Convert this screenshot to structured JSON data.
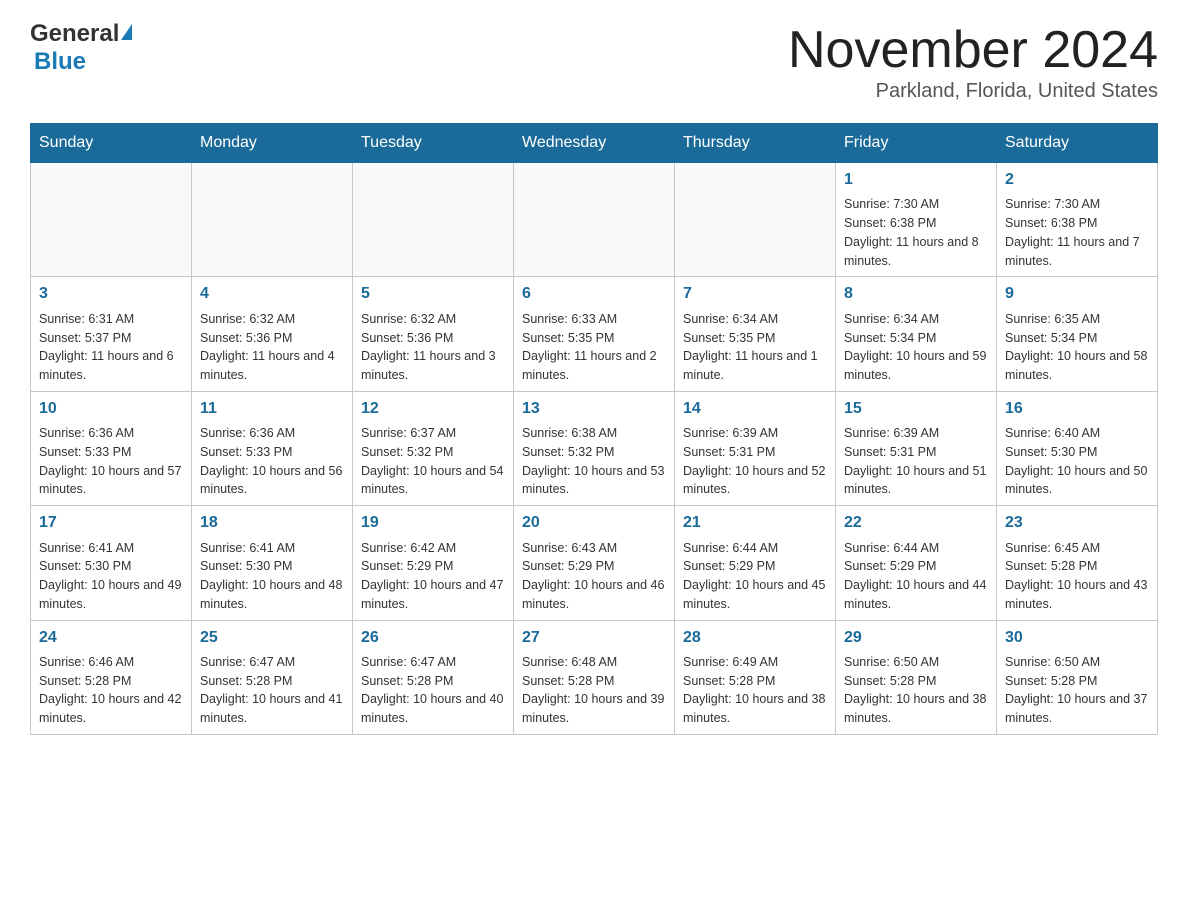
{
  "header": {
    "logo_general": "General",
    "logo_blue": "Blue",
    "month_title": "November 2024",
    "location": "Parkland, Florida, United States"
  },
  "days_of_week": [
    "Sunday",
    "Monday",
    "Tuesday",
    "Wednesday",
    "Thursday",
    "Friday",
    "Saturday"
  ],
  "weeks": [
    [
      {
        "day": "",
        "info": ""
      },
      {
        "day": "",
        "info": ""
      },
      {
        "day": "",
        "info": ""
      },
      {
        "day": "",
        "info": ""
      },
      {
        "day": "",
        "info": ""
      },
      {
        "day": "1",
        "info": "Sunrise: 7:30 AM\nSunset: 6:38 PM\nDaylight: 11 hours and 8 minutes."
      },
      {
        "day": "2",
        "info": "Sunrise: 7:30 AM\nSunset: 6:38 PM\nDaylight: 11 hours and 7 minutes."
      }
    ],
    [
      {
        "day": "3",
        "info": "Sunrise: 6:31 AM\nSunset: 5:37 PM\nDaylight: 11 hours and 6 minutes."
      },
      {
        "day": "4",
        "info": "Sunrise: 6:32 AM\nSunset: 5:36 PM\nDaylight: 11 hours and 4 minutes."
      },
      {
        "day": "5",
        "info": "Sunrise: 6:32 AM\nSunset: 5:36 PM\nDaylight: 11 hours and 3 minutes."
      },
      {
        "day": "6",
        "info": "Sunrise: 6:33 AM\nSunset: 5:35 PM\nDaylight: 11 hours and 2 minutes."
      },
      {
        "day": "7",
        "info": "Sunrise: 6:34 AM\nSunset: 5:35 PM\nDaylight: 11 hours and 1 minute."
      },
      {
        "day": "8",
        "info": "Sunrise: 6:34 AM\nSunset: 5:34 PM\nDaylight: 10 hours and 59 minutes."
      },
      {
        "day": "9",
        "info": "Sunrise: 6:35 AM\nSunset: 5:34 PM\nDaylight: 10 hours and 58 minutes."
      }
    ],
    [
      {
        "day": "10",
        "info": "Sunrise: 6:36 AM\nSunset: 5:33 PM\nDaylight: 10 hours and 57 minutes."
      },
      {
        "day": "11",
        "info": "Sunrise: 6:36 AM\nSunset: 5:33 PM\nDaylight: 10 hours and 56 minutes."
      },
      {
        "day": "12",
        "info": "Sunrise: 6:37 AM\nSunset: 5:32 PM\nDaylight: 10 hours and 54 minutes."
      },
      {
        "day": "13",
        "info": "Sunrise: 6:38 AM\nSunset: 5:32 PM\nDaylight: 10 hours and 53 minutes."
      },
      {
        "day": "14",
        "info": "Sunrise: 6:39 AM\nSunset: 5:31 PM\nDaylight: 10 hours and 52 minutes."
      },
      {
        "day": "15",
        "info": "Sunrise: 6:39 AM\nSunset: 5:31 PM\nDaylight: 10 hours and 51 minutes."
      },
      {
        "day": "16",
        "info": "Sunrise: 6:40 AM\nSunset: 5:30 PM\nDaylight: 10 hours and 50 minutes."
      }
    ],
    [
      {
        "day": "17",
        "info": "Sunrise: 6:41 AM\nSunset: 5:30 PM\nDaylight: 10 hours and 49 minutes."
      },
      {
        "day": "18",
        "info": "Sunrise: 6:41 AM\nSunset: 5:30 PM\nDaylight: 10 hours and 48 minutes."
      },
      {
        "day": "19",
        "info": "Sunrise: 6:42 AM\nSunset: 5:29 PM\nDaylight: 10 hours and 47 minutes."
      },
      {
        "day": "20",
        "info": "Sunrise: 6:43 AM\nSunset: 5:29 PM\nDaylight: 10 hours and 46 minutes."
      },
      {
        "day": "21",
        "info": "Sunrise: 6:44 AM\nSunset: 5:29 PM\nDaylight: 10 hours and 45 minutes."
      },
      {
        "day": "22",
        "info": "Sunrise: 6:44 AM\nSunset: 5:29 PM\nDaylight: 10 hours and 44 minutes."
      },
      {
        "day": "23",
        "info": "Sunrise: 6:45 AM\nSunset: 5:28 PM\nDaylight: 10 hours and 43 minutes."
      }
    ],
    [
      {
        "day": "24",
        "info": "Sunrise: 6:46 AM\nSunset: 5:28 PM\nDaylight: 10 hours and 42 minutes."
      },
      {
        "day": "25",
        "info": "Sunrise: 6:47 AM\nSunset: 5:28 PM\nDaylight: 10 hours and 41 minutes."
      },
      {
        "day": "26",
        "info": "Sunrise: 6:47 AM\nSunset: 5:28 PM\nDaylight: 10 hours and 40 minutes."
      },
      {
        "day": "27",
        "info": "Sunrise: 6:48 AM\nSunset: 5:28 PM\nDaylight: 10 hours and 39 minutes."
      },
      {
        "day": "28",
        "info": "Sunrise: 6:49 AM\nSunset: 5:28 PM\nDaylight: 10 hours and 38 minutes."
      },
      {
        "day": "29",
        "info": "Sunrise: 6:50 AM\nSunset: 5:28 PM\nDaylight: 10 hours and 38 minutes."
      },
      {
        "day": "30",
        "info": "Sunrise: 6:50 AM\nSunset: 5:28 PM\nDaylight: 10 hours and 37 minutes."
      }
    ]
  ]
}
